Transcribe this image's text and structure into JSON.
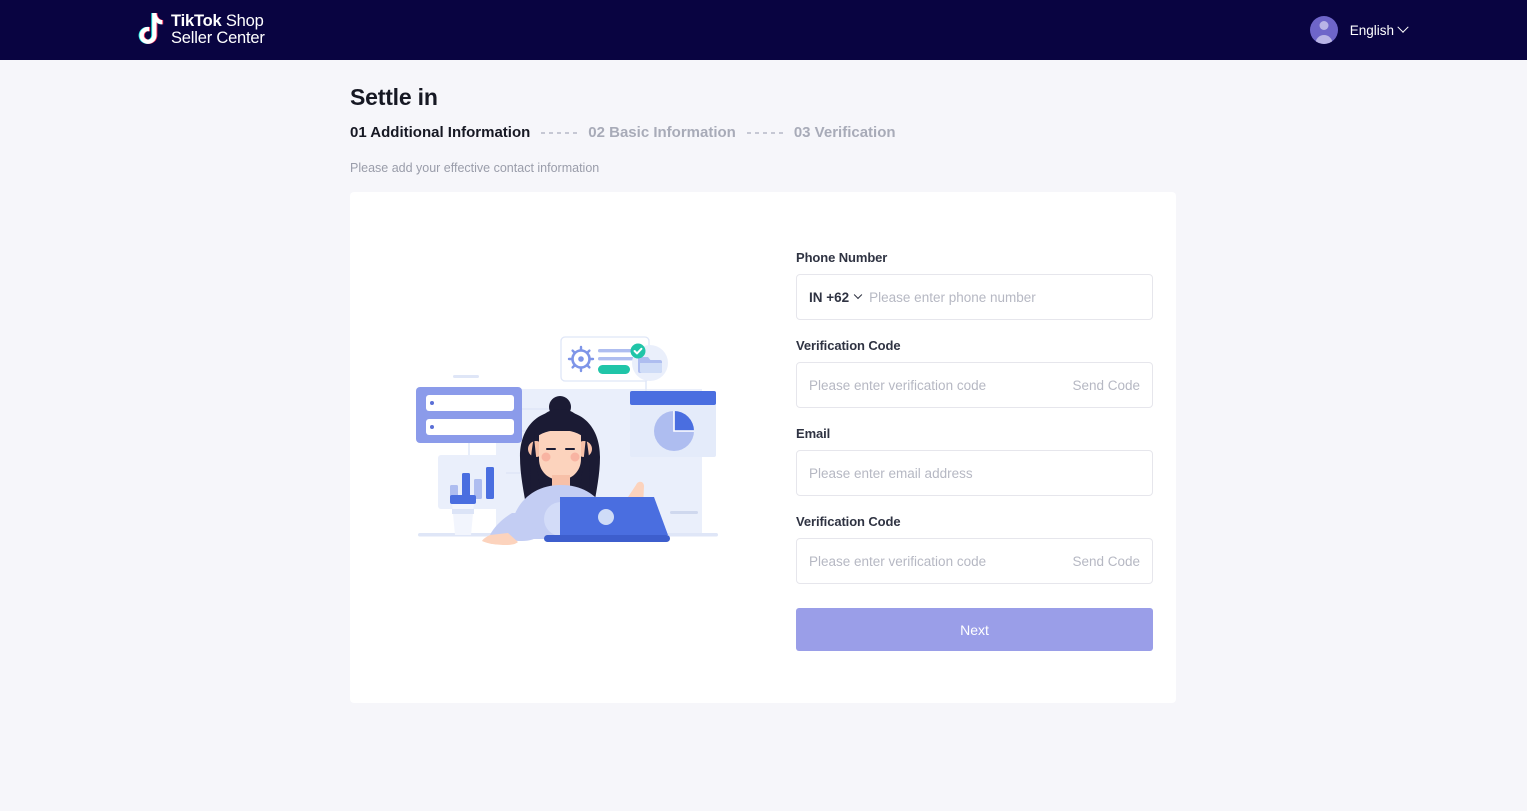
{
  "header": {
    "brand": {
      "logo_icon": "tiktok-note-icon",
      "name_bold": "TikTok",
      "name_light": "Shop",
      "line2": "Seller Center"
    },
    "avatar_icon": "user-avatar-icon",
    "language": "English",
    "language_chevron_icon": "chevron-down-icon",
    "background_color": "#090441"
  },
  "page": {
    "title": "Settle in",
    "subtitle": "Please add your effective contact information",
    "background_color": "#f6f6fa",
    "steps": [
      {
        "label": "01 Additional Information",
        "active": true
      },
      {
        "label": "02 Basic Information",
        "active": false
      },
      {
        "label": "03 Verification",
        "active": false
      }
    ]
  },
  "illustration": {
    "name": "woman-at-laptop-dashboard-illustration",
    "accent_color": "#4a6ee0",
    "soft_color": "#aebdf0"
  },
  "form": {
    "phone": {
      "label": "Phone Number",
      "country_code": "IN +62",
      "country_chevron_icon": "chevron-down-icon",
      "placeholder": "Please enter phone number",
      "value": ""
    },
    "phone_code": {
      "label": "Verification Code",
      "placeholder": "Please enter verification code",
      "value": "",
      "action": "Send Code"
    },
    "email": {
      "label": "Email",
      "placeholder": "Please enter email address",
      "value": ""
    },
    "email_code": {
      "label": "Verification Code",
      "placeholder": "Please enter verification code",
      "value": "",
      "action": "Send Code"
    },
    "submit": {
      "label": "Next",
      "color": "#9a9ee8",
      "text_color": "#ffffff"
    }
  }
}
